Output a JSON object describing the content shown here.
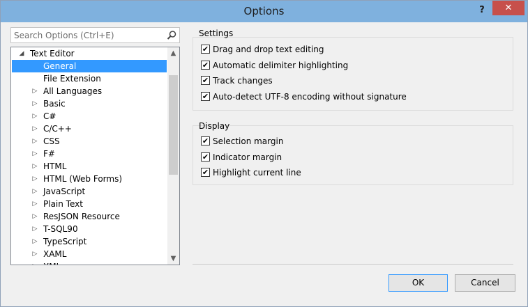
{
  "window": {
    "title": "Options",
    "help_label": "?",
    "close_label": "✕"
  },
  "search": {
    "placeholder": "Search Options (Ctrl+E)"
  },
  "tree": {
    "items": [
      {
        "label": "Text Editor",
        "arrow": "◢",
        "level": 0,
        "selected": false
      },
      {
        "label": "General",
        "arrow": "",
        "level": 1,
        "selected": true
      },
      {
        "label": "File Extension",
        "arrow": "",
        "level": 1,
        "selected": false
      },
      {
        "label": "All Languages",
        "arrow": "▷",
        "level": 1,
        "selected": false
      },
      {
        "label": "Basic",
        "arrow": "▷",
        "level": 1,
        "selected": false
      },
      {
        "label": "C#",
        "arrow": "▷",
        "level": 1,
        "selected": false
      },
      {
        "label": "C/C++",
        "arrow": "▷",
        "level": 1,
        "selected": false
      },
      {
        "label": "CSS",
        "arrow": "▷",
        "level": 1,
        "selected": false
      },
      {
        "label": "F#",
        "arrow": "▷",
        "level": 1,
        "selected": false
      },
      {
        "label": "HTML",
        "arrow": "▷",
        "level": 1,
        "selected": false
      },
      {
        "label": "HTML (Web Forms)",
        "arrow": "▷",
        "level": 1,
        "selected": false
      },
      {
        "label": "JavaScript",
        "arrow": "▷",
        "level": 1,
        "selected": false
      },
      {
        "label": "Plain Text",
        "arrow": "▷",
        "level": 1,
        "selected": false
      },
      {
        "label": "ResJSON Resource",
        "arrow": "▷",
        "level": 1,
        "selected": false
      },
      {
        "label": "T-SQL90",
        "arrow": "▷",
        "level": 1,
        "selected": false
      },
      {
        "label": "TypeScript",
        "arrow": "▷",
        "level": 1,
        "selected": false
      },
      {
        "label": "XAML",
        "arrow": "▷",
        "level": 1,
        "selected": false
      },
      {
        "label": "XML",
        "arrow": "▷",
        "level": 1,
        "selected": false
      }
    ],
    "scroll_up": "▲",
    "scroll_down": "▼"
  },
  "settings": {
    "title": "Settings",
    "options": [
      {
        "label": "Drag and drop text editing",
        "checked": true
      },
      {
        "label": "Automatic delimiter highlighting",
        "checked": true
      },
      {
        "label": "Track changes",
        "checked": true
      },
      {
        "label": "Auto-detect UTF-8 encoding without signature",
        "checked": true
      }
    ]
  },
  "display": {
    "title": "Display",
    "options": [
      {
        "label": "Selection margin",
        "checked": true
      },
      {
        "label": "Indicator margin",
        "checked": true
      },
      {
        "label": "Highlight current line",
        "checked": true
      }
    ]
  },
  "buttons": {
    "ok": "OK",
    "cancel": "Cancel"
  },
  "colors": {
    "titlebar": "#7fb1de",
    "selection": "#3399ff",
    "close": "#c7504b"
  },
  "icons": {
    "search": "search-icon",
    "checkmark": "✔"
  }
}
